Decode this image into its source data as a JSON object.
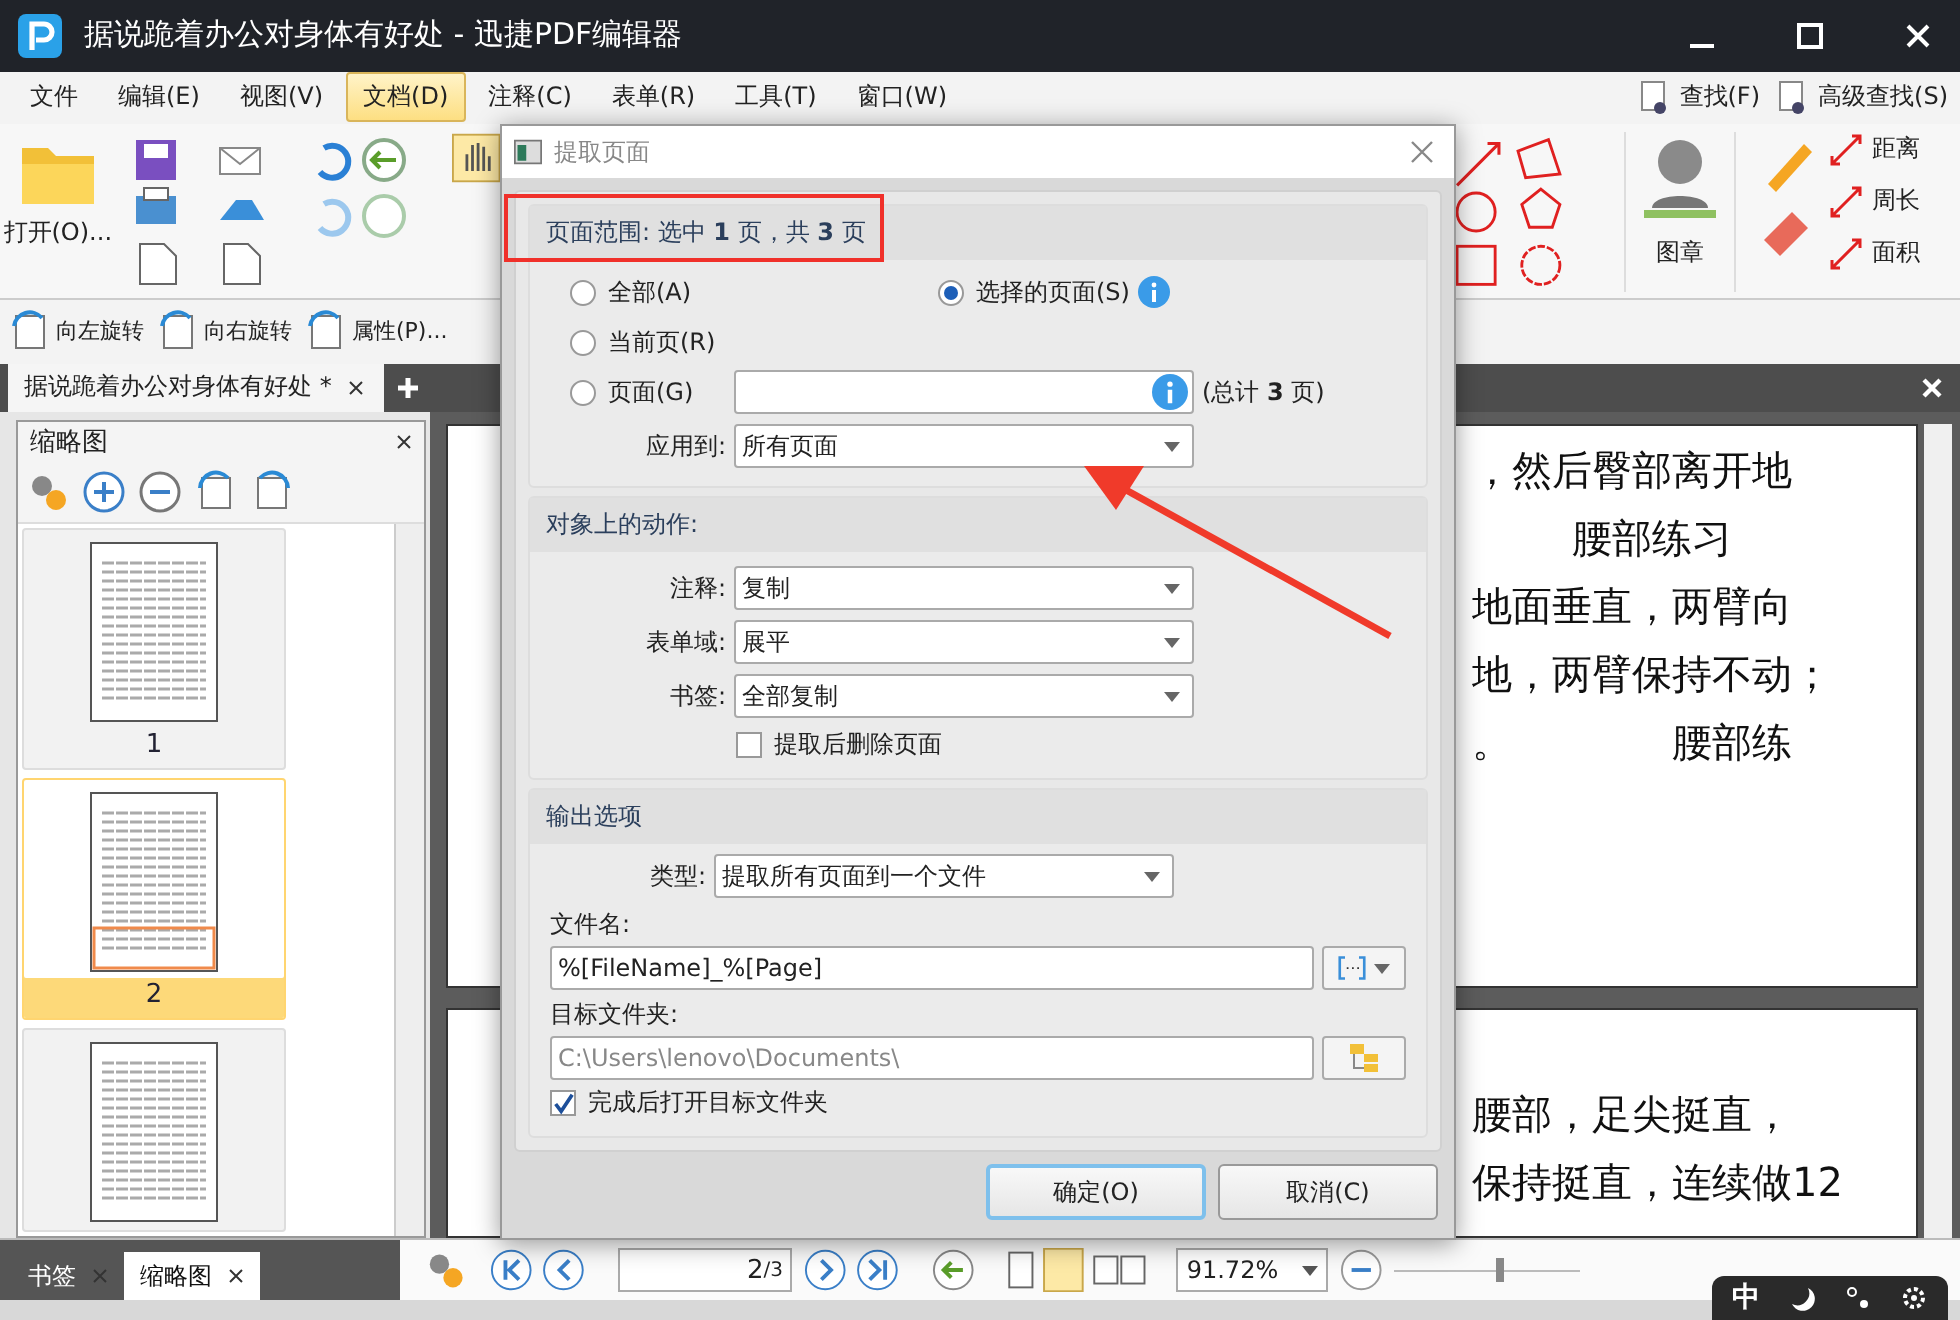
{
  "window": {
    "title": "据说跪着办公对身体有好处 - 迅捷PDF编辑器"
  },
  "menu": [
    {
      "label": "文件",
      "selected": false
    },
    {
      "label": "编辑(E)",
      "selected": false
    },
    {
      "label": "视图(V)",
      "selected": false
    },
    {
      "label": "文档(D)",
      "selected": true
    },
    {
      "label": "注释(C)",
      "selected": false
    },
    {
      "label": "表单(R)",
      "selected": false
    },
    {
      "label": "工具(T)",
      "selected": false
    },
    {
      "label": "窗口(W)",
      "selected": false
    }
  ],
  "search_buttons": [
    "查找(F)",
    "高级查找(S)"
  ],
  "ribbon": {
    "open_label": "打开(O)...",
    "stamp_label": "图章",
    "measure": [
      "距离",
      "周长",
      "面积"
    ]
  },
  "toolbar2": [
    "向左旋转",
    "向右旋转",
    "属性(P)..."
  ],
  "doc_tabs": [
    {
      "label": "据说跪着办公对身体有好处 *",
      "selected": true
    }
  ],
  "thumbnail_panel": {
    "title": "缩略图",
    "thumbnails": [
      {
        "number": "1",
        "selected": false
      },
      {
        "number": "2",
        "selected": true
      },
      {
        "selected": false
      }
    ]
  },
  "panel_tabs": [
    {
      "label": "书签",
      "selected": false
    },
    {
      "label": "缩略图",
      "selected": true
    }
  ],
  "document": {
    "page1_lines": [
      "，然后臀部离开地",
      "腰部练习",
      "地面垂直，两臂向",
      "地，两臂保持不动；"
    ],
    "page1_tail": [
      "。",
      "腰部练"
    ],
    "page2_lines": [
      "腰部，足尖挺直，",
      "保持挺直，连续做12"
    ]
  },
  "statusbar": {
    "page_input": "2",
    "page_total": "/3",
    "zoom": "91.72%",
    "zoom_slider": {
      "level": 0.55
    }
  },
  "ime": {
    "mode": "中"
  },
  "dialog": {
    "title": "提取页面",
    "range_header": "页面范围: 选中 **1** 页，共 **3** 页",
    "radios": [
      {
        "label": "全部(A)",
        "selected": false
      },
      {
        "label": "选择的页面(S)",
        "selected": true
      },
      {
        "label": "当前页(R)",
        "selected": false
      },
      {
        "label": "页面(G)",
        "selected": false
      }
    ],
    "total": "(总计 **3** 页)",
    "apply_label": "应用到:",
    "apply_value": "所有页面",
    "actions_header": "对象上的动作:",
    "actions": [
      {
        "label": "注释:",
        "value": "复制"
      },
      {
        "label": "表单域:",
        "value": "展平"
      },
      {
        "label": "书签:",
        "value": "全部复制"
      }
    ],
    "delete_checkbox": {
      "label": "提取后删除页面",
      "checked": false
    },
    "output_header": "输出选项",
    "type_label": "类型:",
    "type_value": "提取所有页面到一个文件",
    "filename_label": "文件名:",
    "filename_value": "%[FileName]_%[Page]",
    "folder_label": "目标文件夹:",
    "folder_value": "C:\\Users\\lenovo\\Documents\\",
    "open_checkbox": {
      "label": "完成后打开目标文件夹",
      "checked": true
    },
    "buttons": [
      "确定(O)",
      "取消(C)"
    ]
  }
}
